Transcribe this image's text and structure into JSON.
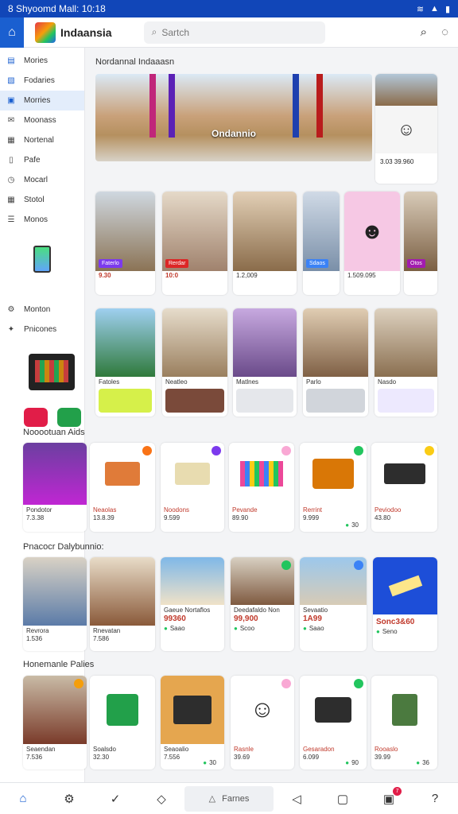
{
  "status": {
    "text": "8 Shyoomd Mall: 10:18"
  },
  "app": {
    "name": "Indaansia"
  },
  "search": {
    "placeholder": "Sartch"
  },
  "sidebar": {
    "items": [
      {
        "label": "Mories",
        "icon": "menu-icon"
      },
      {
        "label": "Fodaries",
        "icon": "category-icon"
      },
      {
        "label": "Morries",
        "icon": "bag-icon"
      },
      {
        "label": "Moonass",
        "icon": "mail-icon"
      },
      {
        "label": "Nortenal",
        "icon": "calendar-icon"
      },
      {
        "label": "Pafe",
        "icon": "document-icon"
      },
      {
        "label": "Mocarl",
        "icon": "clock-icon"
      },
      {
        "label": "Stotol",
        "icon": "grid-icon"
      },
      {
        "label": "Monos",
        "icon": "list-icon"
      }
    ],
    "items2": [
      {
        "label": "Monton",
        "icon": "settings-icon"
      },
      {
        "label": "Pnicones",
        "icon": "gift-icon"
      }
    ]
  },
  "main": {
    "section1": "Nordannal Indaaasn",
    "hero_caption": "Ondannio",
    "side_price": "3.03 39.960",
    "row1": [
      {
        "price": "9.30",
        "tag": "Faterlo"
      },
      {
        "price": "10:0",
        "tag": "Rerdar"
      },
      {
        "price": "1.2,009",
        "tag": ""
      },
      {
        "price": "",
        "tag": "Sdaos"
      },
      {
        "price": "1.509.095",
        "tag": ""
      },
      {
        "price": "",
        "tag": "Otos"
      }
    ],
    "row2": [
      {
        "label": "Fatoles"
      },
      {
        "label": "Neatleo"
      },
      {
        "label": "Matlnes"
      },
      {
        "label": "Parlo"
      },
      {
        "label": "Nasdo"
      }
    ],
    "section2": "Nooootuan Aids",
    "row3": [
      {
        "label": "Pondotor",
        "price": "7.3.38"
      },
      {
        "label": "Neaolas",
        "price": "13.8.39"
      },
      {
        "label": "Noodons",
        "price": "9.599"
      },
      {
        "label": "Pevande",
        "price": "89.90"
      },
      {
        "label": "Rerrint",
        "price": "9.999"
      },
      {
        "label": "Peviodoo",
        "price": "43.80"
      }
    ],
    "row3_extra": "30",
    "section3": "Pnacocr Dalybunnio:",
    "row4": [
      {
        "label": "Revrora",
        "price": "1.536"
      },
      {
        "label": "Rnevatan",
        "price": "7.586"
      },
      {
        "label": "Gaeue Nortaflos",
        "price": "99360",
        "sub": "Saao"
      },
      {
        "label": "Deedafaldo Non",
        "price": "99,900",
        "sub": "Scoo"
      },
      {
        "label": "Sevaatio",
        "price": "1A99",
        "sub": "Saao"
      },
      {
        "label": "",
        "price": "Sonc3&60",
        "sub": "Seno"
      }
    ],
    "section4": "Honemanle Palies",
    "row5": [
      {
        "label": "Seaendan",
        "price": "7.536"
      },
      {
        "label": "Soalsdo",
        "price": "32.30"
      },
      {
        "label": "Seaoalio",
        "price": "7.556"
      },
      {
        "label": "Rasnle",
        "price": "39.69"
      },
      {
        "label": "Gesaradon",
        "price": "6.099"
      },
      {
        "label": "Rooaslo",
        "price": "39.99"
      }
    ],
    "row5_extra": [
      "30",
      "90",
      "36"
    ]
  },
  "bottom": {
    "mid_label": "Farnes"
  },
  "colors": {
    "accent": "#1a5fd0",
    "statusbar": "#1146b8"
  }
}
